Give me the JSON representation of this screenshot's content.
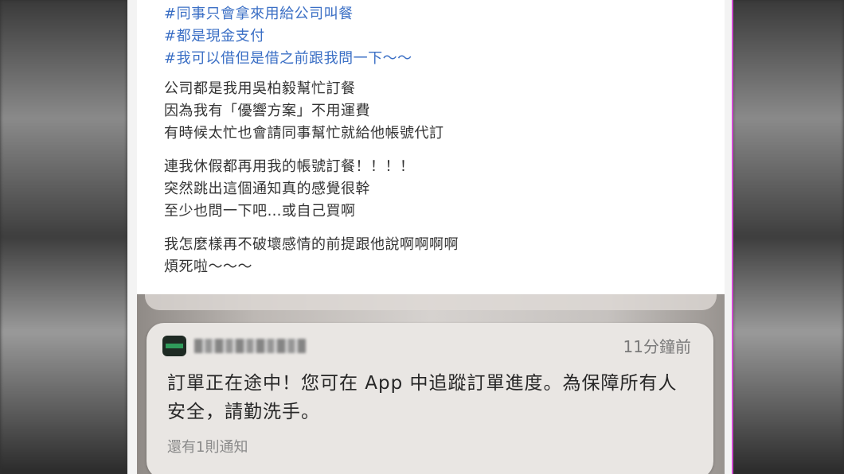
{
  "post": {
    "hashtags": [
      "#同事只會拿來用給公司叫餐",
      "#都是現金支付",
      "#我可以借但是借之前跟我問一下～～"
    ],
    "paragraphs": [
      [
        "公司都是我用吳柏毅幫忙訂餐",
        "因為我有「優響方案」不用運費",
        "有時候太忙也會請同事幫忙就給他帳號代訂"
      ],
      [
        "連我休假都再用我的帳號訂餐！！！！",
        "突然跳出這個通知真的感覺很幹",
        "至少也問一下吧…或自己買啊"
      ],
      [
        "我怎麼樣再不破壞感情的前提跟他說啊啊啊啊",
        "煩死啦～～～"
      ]
    ]
  },
  "notification": {
    "time": "11分鐘前",
    "body": "訂單正在途中！您可在 App 中追蹤訂單進度。為保障所有人安全，請勤洗手。",
    "more": "還有1則通知",
    "icon": "app-icon",
    "icon_colors": {
      "background": "#1e2a23",
      "bar": "#2f9b5a"
    }
  }
}
